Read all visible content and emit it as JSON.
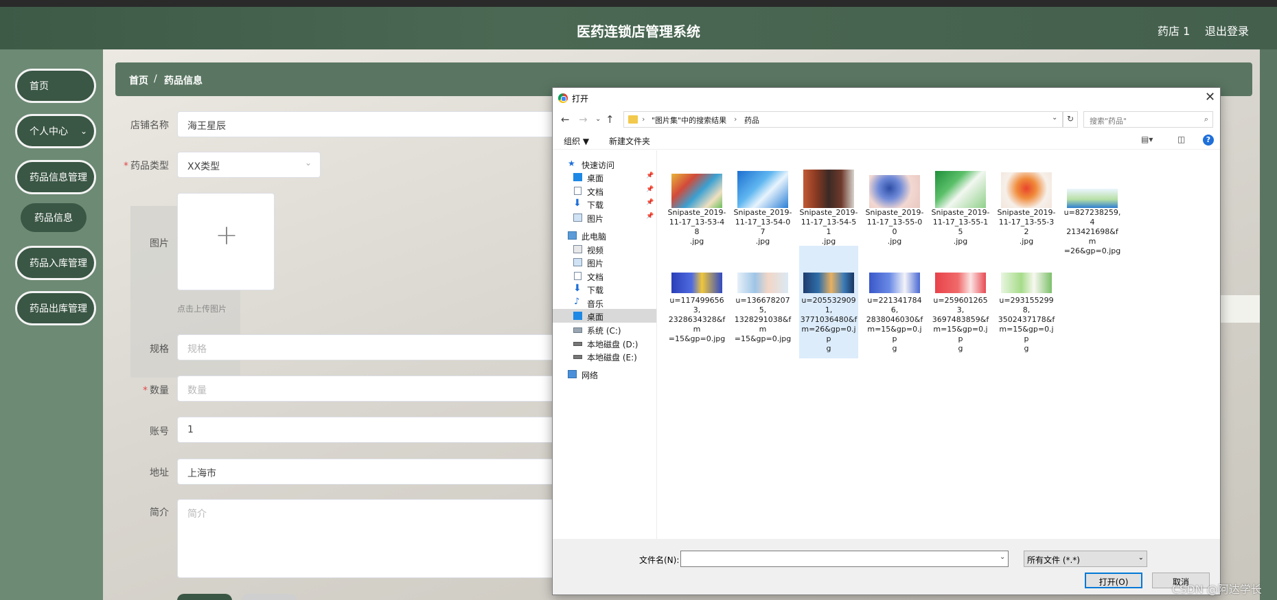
{
  "header": {
    "title": "医药连锁店管理系统",
    "user": "药店 1",
    "logout": "退出登录"
  },
  "sidebar": {
    "items": [
      {
        "label": "首页"
      },
      {
        "label": "个人中心"
      },
      {
        "label": "药品信息管理"
      },
      {
        "label": "药品信息"
      },
      {
        "label": "药品入库管理"
      },
      {
        "label": "药品出库管理"
      }
    ]
  },
  "breadcrumb": {
    "home": "首页",
    "sep": "/",
    "current": "药品信息"
  },
  "form": {
    "shop_name": {
      "label": "店铺名称",
      "value": "海王星辰"
    },
    "drug_type": {
      "label": "药品类型",
      "value": "XX类型"
    },
    "image": {
      "label": "图片",
      "hint": "点击上传图片"
    },
    "spec": {
      "label": "规格",
      "placeholder": "规格"
    },
    "quantity": {
      "label": "数量",
      "placeholder": "数量"
    },
    "account": {
      "label": "账号",
      "value": "1"
    },
    "address": {
      "label": "地址",
      "value": "上海市"
    },
    "intro": {
      "label": "简介",
      "placeholder": "简介"
    },
    "required_mark": "*"
  },
  "dialog": {
    "title": "打开",
    "path": [
      "\"图片集\"中的搜索结果",
      "药品"
    ],
    "search_placeholder": "搜索\"药品\"",
    "toolbar": {
      "organize": "组织 ▼",
      "new_folder": "新建文件夹"
    },
    "nav": {
      "quick_access": "快速访问",
      "desktop": "桌面",
      "documents": "文档",
      "downloads": "下载",
      "pictures": "图片",
      "this_pc": "此电脑",
      "videos": "视频",
      "pictures2": "图片",
      "documents2": "文档",
      "downloads2": "下载",
      "music": "音乐",
      "desktop2": "桌面",
      "drive_c": "系统 (C:)",
      "drive_d": "本地磁盘 (D:)",
      "drive_e": "本地磁盘 (E:)",
      "network": "网络"
    },
    "files": [
      {
        "name": "Snipaste_2019-11-17_13-53-48.jpg",
        "lines": [
          "Snipaste_2019-",
          "11-17_13-53-48",
          ".jpg"
        ]
      },
      {
        "name": "Snipaste_2019-11-17_13-54-07.jpg",
        "lines": [
          "Snipaste_2019-",
          "11-17_13-54-07",
          ".jpg"
        ]
      },
      {
        "name": "Snipaste_2019-11-17_13-54-51.jpg",
        "lines": [
          "Snipaste_2019-",
          "11-17_13-54-51",
          ".jpg"
        ]
      },
      {
        "name": "Snipaste_2019-11-17_13-55-00.jpg",
        "lines": [
          "Snipaste_2019-",
          "11-17_13-55-00",
          ".jpg"
        ]
      },
      {
        "name": "Snipaste_2019-11-17_13-55-15.jpg",
        "lines": [
          "Snipaste_2019-",
          "11-17_13-55-15",
          ".jpg"
        ]
      },
      {
        "name": "Snipaste_2019-11-17_13-55-32.jpg",
        "lines": [
          "Snipaste_2019-",
          "11-17_13-55-32",
          ".jpg"
        ]
      },
      {
        "name": "u=827238259,4213421698&fm=26&gp=0.jpg",
        "lines": [
          "u=827238259,4",
          "213421698&fm",
          "=26&gp=0.jpg"
        ]
      },
      {
        "name": "u=1174996563,2328634328&fm=15&gp=0.jpg",
        "lines": [
          "u=1174996563,",
          "2328634328&fm",
          "=15&gp=0.jpg"
        ]
      },
      {
        "name": "u=1366782075,1328291038&fm=15&gp=0.jpg",
        "lines": [
          "u=1366782075,",
          "1328291038&fm",
          "=15&gp=0.jpg"
        ]
      },
      {
        "name": "u=2055329091,3771036480&fm=26&gp=0.jpg",
        "lines": [
          "u=2055329091,",
          "3771036480&f",
          "m=26&gp=0.jp",
          "g"
        ]
      },
      {
        "name": "u=2213417846,2838046030&fm=15&gp=0.jpg",
        "lines": [
          "u=2213417846,",
          "2838046030&f",
          "m=15&gp=0.jp",
          "g"
        ]
      },
      {
        "name": "u=2596012653,3697483859&fm=15&gp=0.jpg",
        "lines": [
          "u=2596012653,",
          "3697483859&f",
          "m=15&gp=0.jp",
          "g"
        ]
      },
      {
        "name": "u=2931552998,3502437178&fm=15&gp=0.jpg",
        "lines": [
          "u=2931552998,",
          "3502437178&f",
          "m=15&gp=0.jp",
          "g"
        ]
      }
    ],
    "filename_label": "文件名(N):",
    "filename_value": "",
    "filetype": "所有文件 (*.*)",
    "open_button": "打开(O)",
    "cancel_button": "取消"
  },
  "watermark": "CSDN @阿达学长",
  "colors": {
    "header_green": "#4a6853",
    "sidebar_button": "#3a5644",
    "breadcrumb": "#5a7662",
    "selection": "#dcecfb",
    "accent_blue": "#0078d7"
  }
}
